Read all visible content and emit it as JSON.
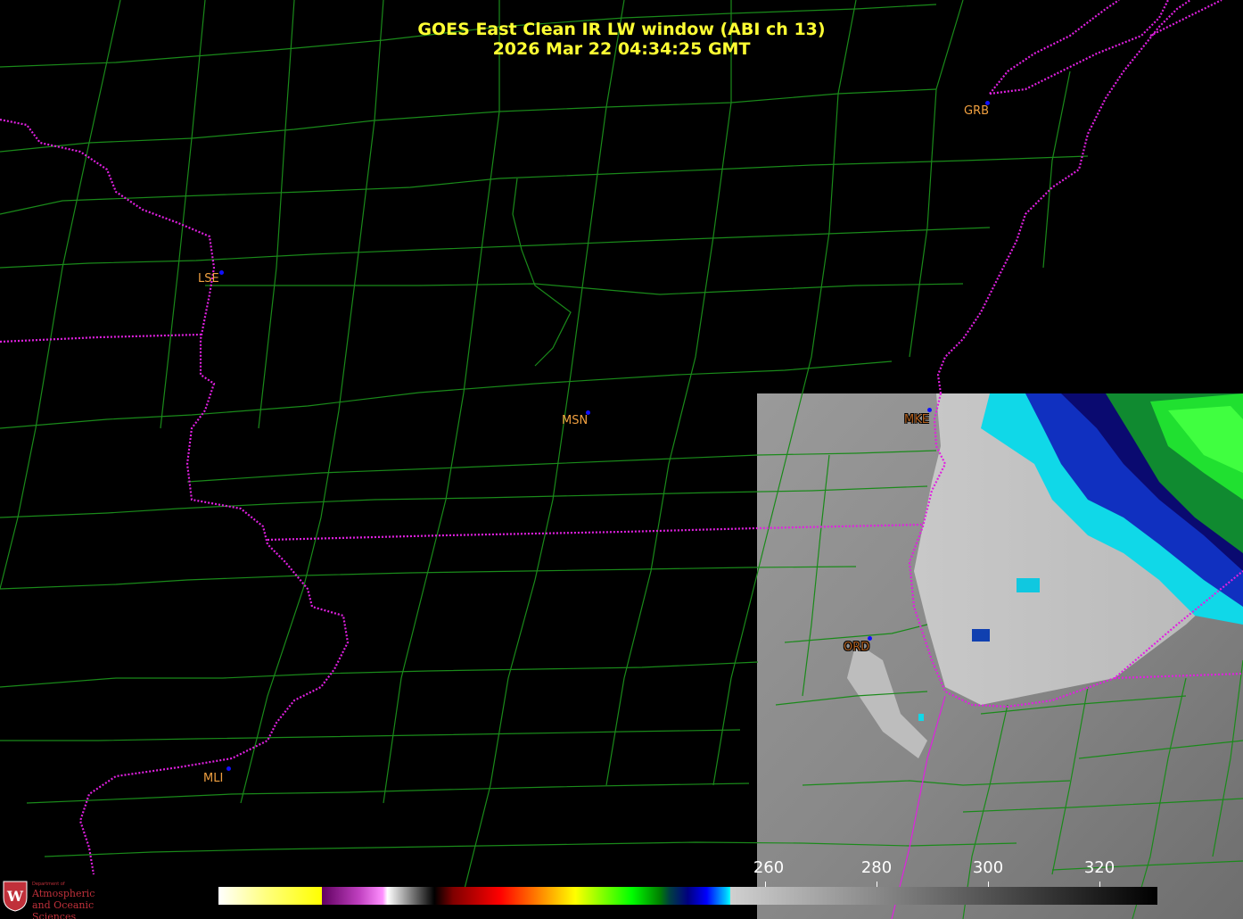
{
  "title": {
    "line1": "GOES East Clean IR LW window (ABI ch 13)",
    "line2": "2026 Mar 22  04:34:25 GMT"
  },
  "stations": [
    {
      "id": "GRB",
      "style": "plain"
    },
    {
      "id": "LSE",
      "style": "plain"
    },
    {
      "id": "MSN",
      "style": "plain"
    },
    {
      "id": "MKE",
      "style": "boxed"
    },
    {
      "id": "ORD",
      "style": "boxed"
    },
    {
      "id": "MLI",
      "style": "plain"
    }
  ],
  "colorbar": {
    "tick_labels": [
      "260",
      "280",
      "300",
      "320"
    ],
    "colors": {
      "background": "#000000",
      "county_lines": "#1a8a1a",
      "state_and_coast": "#e020e0",
      "station_dot": "#1010ff",
      "label_text": "#f0a040",
      "title_text": "#ffff33"
    }
  },
  "logo": {
    "dept": "Department of",
    "line1": "Atmospheric",
    "line2": "and Oceanic Sciences",
    "icon": "uw-crest-icon"
  }
}
